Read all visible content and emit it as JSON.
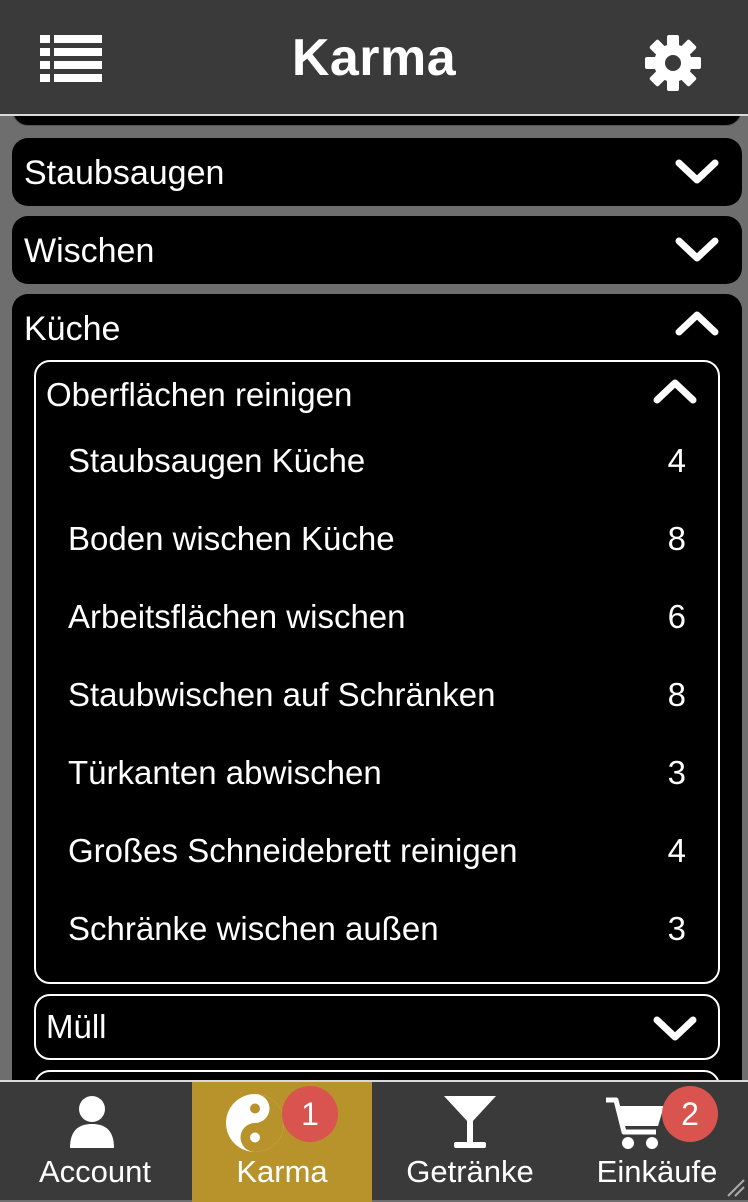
{
  "header": {
    "title": "Karma",
    "menu_icon": "list-icon",
    "settings_icon": "gear-icon"
  },
  "categories": [
    {
      "label": "Staubsaugen",
      "expanded": false
    },
    {
      "label": "Wischen",
      "expanded": false
    },
    {
      "label": "Küche",
      "expanded": true,
      "subcategories": [
        {
          "label": "Oberflächen reinigen",
          "expanded": true,
          "tasks": [
            {
              "name": "Staubsaugen Küche",
              "points": "4"
            },
            {
              "name": "Boden wischen Küche",
              "points": "8"
            },
            {
              "name": "Arbeitsflächen wischen",
              "points": "6"
            },
            {
              "name": "Staubwischen auf Schränken",
              "points": "8"
            },
            {
              "name": "Türkanten abwischen",
              "points": "3"
            },
            {
              "name": "Großes Schneidebrett reinigen",
              "points": "4"
            },
            {
              "name": "Schränke wischen außen",
              "points": "3"
            }
          ]
        },
        {
          "label": "Müll",
          "expanded": false
        }
      ]
    }
  ],
  "tabbar": {
    "active": "Karma",
    "accent_color": "#b8922a",
    "badge_color": "#d9534f",
    "tabs": [
      {
        "label": "Account",
        "icon": "user-icon",
        "badge": ""
      },
      {
        "label": "Karma",
        "icon": "yin-yang-icon",
        "badge": "1"
      },
      {
        "label": "Getränke",
        "icon": "cocktail-glass-icon",
        "badge": ""
      },
      {
        "label": "Einkäufe",
        "icon": "shopping-cart-icon",
        "badge": "2"
      }
    ]
  }
}
